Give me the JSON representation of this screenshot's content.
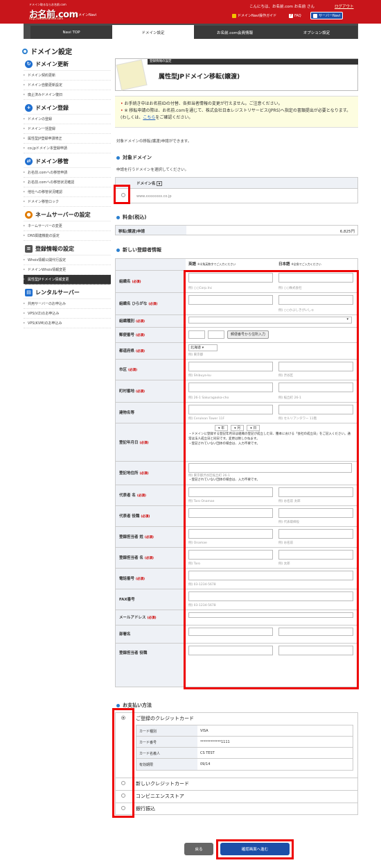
{
  "header": {
    "logo_tag": "ドメイン取るならお名前.com",
    "logo": "お名前.com",
    "logo_url": "http://www.onamae.com",
    "logo_suffix": "ドメインNavi",
    "greeting": "こんにちは、お名前.com お名前 さん",
    "logout": "ログアウト",
    "guide": "ドメインNavi操作ガイド",
    "faq": "FAQ",
    "server_navi": "サーバーNavi"
  },
  "tabs": [
    "Navi TOP",
    "ドメイン設定",
    "お名前.com会員情報",
    "オプション設定"
  ],
  "page_title": "ドメイン設定",
  "sidebar": [
    {
      "title": "ドメイン更新",
      "color": "#1f6fd0",
      "items": [
        "ドメイン契約更新",
        "ドメイン自動更新設定",
        "廃止済みドメイン復旧"
      ]
    },
    {
      "title": "ドメイン登録",
      "color": "#1f6fd0",
      "items": [
        "ドメインの登録",
        "ドメイン一括登録",
        "属性型JP登録申請修正",
        "co.jpドメイン本登録申請"
      ]
    },
    {
      "title": "ドメイン移管",
      "color": "#1f6fd0",
      "items": [
        "お名前.comへの移管申請",
        "お名前.comへの移管状況確認",
        "他社への移管状況確認",
        "ドメイン移管ロック"
      ]
    },
    {
      "title": "ネームサーバーの設定",
      "color": "#e07b00",
      "items": [
        "ネームサーバーの変更",
        "DNS関連機能の設定"
      ]
    },
    {
      "title": "登録情報の設定",
      "color": "#555",
      "items": [
        "Whois情報公開代行設定",
        "ドメインWhois情報変更",
        "属性型JPドメイン情報変更"
      ]
    },
    {
      "title": "レンタルサーバー",
      "color": "#1f6fd0",
      "items": [
        "共用サーバーのお申込み",
        "VPS(VZ)のお申込み",
        "VPS(KVM)のお申込み"
      ]
    }
  ],
  "sidebar_active": "属性型JPドメイン情報変更",
  "title_box": {
    "label": "登録情報の設定",
    "title": "属性型JPドメイン移転(譲渡)"
  },
  "notice": {
    "line1": "お手続き中はお名前IDの付替、各担当者情報の変更が行えません。ご注意ください。",
    "line2a": "※ 移転申請の際は、お名前.comを通じて、株式会社日本レジストリサービス(JPRS)へ指定の書類提出が必要となります。(わしくは、",
    "link": "こちら",
    "line2b": "をご確認ください。"
  },
  "intro": "対象ドメインの移転(譲渡)申請ができます。",
  "target": {
    "heading": "対象ドメイン",
    "desc": "申請を行うドメインを選択してください。",
    "col": "ドメイン名",
    "domain": "www.xxxxxxxx.co.jp"
  },
  "fee": {
    "heading": "料金(税込)",
    "label": "移転(譲渡)申請",
    "amount": "6,825円"
  },
  "registrant": {
    "heading": "新しい登録者情報",
    "col_en": "英語",
    "col_en_note": "※半角英数字でご入力ください",
    "col_ja": "日本語",
    "col_ja_note": "※全角でご入力ください",
    "required": "(必須)",
    "rows": [
      {
        "label": "組織名",
        "req": true,
        "en": "例) ○○Corp.Inc",
        "ja": "例) ○○株式会社"
      },
      {
        "label": "組織名 ひらがな",
        "req": true,
        "en": "",
        "ja": "例) ○○かぶしきがいしゃ"
      },
      {
        "label": "組織種別",
        "req": true,
        "en": "",
        "ja": ""
      },
      {
        "label": "郵便番号",
        "req": true,
        "en": "",
        "ja": ""
      },
      {
        "label": "都道府県",
        "req": true,
        "en": "北海道",
        "ja": "例) 東京都"
      },
      {
        "label": "市区",
        "req": true,
        "en": "例) Shibuya-ku",
        "ja": "例) 渋谷区"
      },
      {
        "label": "町村番地",
        "req": true,
        "en": "例) 26-1 Sakuragaoka-cho",
        "ja": "例) 桜丘町 26-1"
      },
      {
        "label": "建物名等",
        "req": false,
        "en": "例) Cerulean Tower 11F",
        "ja": "例) セルリアンタワー 11階"
      },
      {
        "label": "登記年月日",
        "req": true,
        "en": "",
        "ja": ""
      },
      {
        "label": "登記地住所",
        "req": true,
        "en": "例) 東京都渋谷区桜丘町 26-1",
        "ja": ""
      },
      {
        "label": "代表者 名",
        "req": true,
        "en": "例) Taro Onamae",
        "ja": "例) お名前 太郎"
      },
      {
        "label": "代表者 役職",
        "req": true,
        "en": "",
        "ja": "例) 代表取締役"
      },
      {
        "label": "登録担当者 姓",
        "req": true,
        "en": "例) Onamae",
        "ja": "例) お名前"
      },
      {
        "label": "登録担当者 名",
        "req": true,
        "en": "例) Taro",
        "ja": "例) 太郎"
      },
      {
        "label": "電話番号",
        "req": true,
        "en": "例) 03-1234-5678",
        "ja": ""
      },
      {
        "label": "FAX番号",
        "req": false,
        "en": "例) 03-1234-5678",
        "ja": ""
      },
      {
        "label": "メールアドレス",
        "req": true,
        "en": "",
        "ja": ""
      },
      {
        "label": "部署名",
        "req": false,
        "en": "",
        "ja": ""
      },
      {
        "label": "登録担当者 役職",
        "req": false,
        "en": "",
        "ja": ""
      }
    ],
    "zip_button": "郵便番号から住所入力",
    "date_year": "年",
    "date_month": "月",
    "date_day": "日",
    "date_note1": "・ドメインに登録する登記年月日は組織の登記が成立した日、謄本における「会社の成立日」をご記入ください。通常は法人成立日と同日です。変更は致しかねます。",
    "date_note2": "・登記されていない団体の場合は、入力不要です。",
    "addr_note": "・登記されていない団体の場合は、入力不要です。"
  },
  "payment": {
    "heading": "お支払い方法",
    "registered": "ご登録のクレジットカード",
    "card": [
      {
        "k": "カード種別",
        "v": "VISA"
      },
      {
        "k": "カード番号",
        "v": "************1111"
      },
      {
        "k": "カード名義人",
        "v": "CS TEST"
      },
      {
        "k": "有効期限",
        "v": "09/14"
      }
    ],
    "options": [
      "新しいクレジットカード",
      "コンビニエンスストア",
      "銀行振込"
    ]
  },
  "buttons": {
    "back": "戻る",
    "confirm": "確認画面へ進む"
  }
}
